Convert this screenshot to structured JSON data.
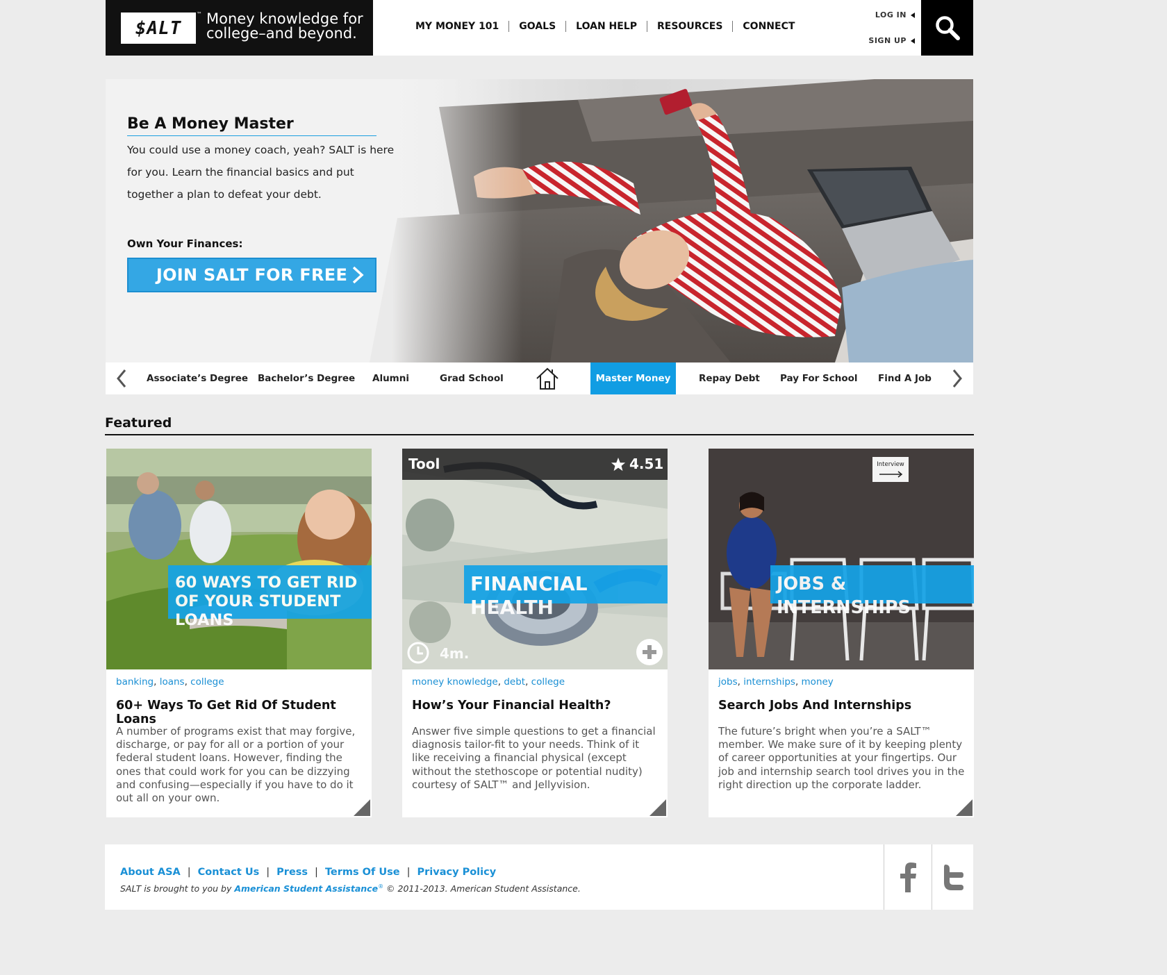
{
  "header": {
    "logo": "$ALT",
    "tm": "™",
    "tagline_line1": "Money knowledge for",
    "tagline_line2": "college–and beyond.",
    "nav": [
      "MY MONEY 101",
      "GOALS",
      "LOAN HELP",
      "RESOURCES",
      "CONNECT"
    ],
    "login": "LOG IN",
    "signup": "SIGN UP"
  },
  "hero": {
    "title": "Be A Money Master",
    "text": "You could use a money coach, yeah? SALT is here for you. Learn the financial basics and put together a plan to defeat your debt.",
    "sub": "Own Your Finances:",
    "button": "JOIN SALT FOR FREE"
  },
  "categories": {
    "items": [
      "Associate’s Degree",
      "Bachelor’s Degree",
      "Alumni",
      "Grad School",
      "Master Money",
      "Repay  Debt",
      "Pay For School",
      "Find A Job"
    ],
    "active": "Master Money"
  },
  "featured": {
    "title": "Featured",
    "cards": [
      {
        "banner": "60 WAYS TO GET RID OF YOUR STUDENT LOANS",
        "tags": [
          "banking",
          "loans",
          "college"
        ],
        "title": "60+ Ways To Get Rid Of Student Loans",
        "text": "A number of programs exist that may forgive, discharge, or pay for all or a portion of your federal student loans. However, finding the ones that could work for you can be dizzying and confusing—especially if you have to do it out all on your own."
      },
      {
        "type_label": "Tool",
        "rating": "4.51",
        "duration": "4m.",
        "banner": "FINANCIAL HEALTH",
        "tags": [
          "money knowledge",
          "debt",
          "college"
        ],
        "title": "How’s Your Financial Health?",
        "text": "Answer five simple questions to get a financial diagnosis tailor-fit to your needs. Think of it like receiving a financial physical (except without the stethoscope or potential nudity) courtesy of SALT™ and Jellyvision."
      },
      {
        "banner": "JOBS & INTERNSHIPS",
        "sign": "Interview",
        "tags": [
          "jobs",
          "internships",
          "money"
        ],
        "title": "Search Jobs And Internships",
        "text": "The future’s bright when you’re a SALT™ member. We make sure of it by keeping plenty of career opportunities at your fingertips. Our job and internship search tool drives you in the right direction up the corporate ladder."
      }
    ]
  },
  "footer": {
    "links": [
      "About ASA",
      "Contact Us",
      "Press",
      "Terms Of Use",
      "Privacy Policy"
    ],
    "copy_prefix": "SALT is brought to you by ",
    "copy_org": "American Student Assistance",
    "copy_reg": "®",
    "copy_suffix": " © 2011-2013. American Student Assistance."
  },
  "colors": {
    "accent": "#119de3",
    "link": "#1a90d6",
    "header_dark": "#111111"
  }
}
